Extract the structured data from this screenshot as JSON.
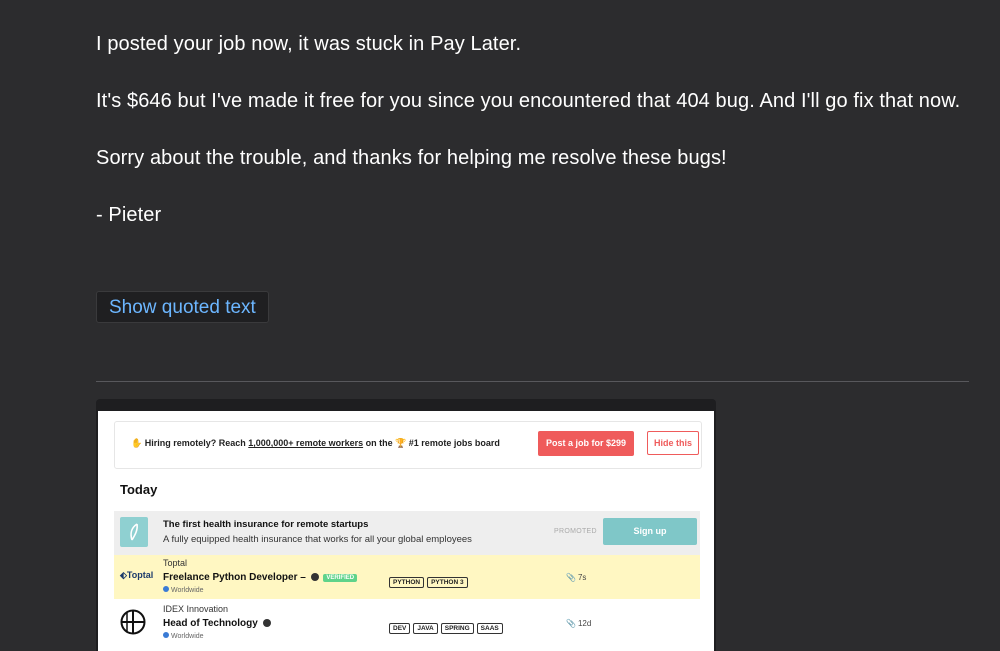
{
  "email": {
    "paragraphs": [
      "I posted your job now, it was stuck in Pay Later.",
      "It's $646 but I've made it free for you since you encountered that 404 bug. And I'll go fix that now.",
      "Sorry about the trouble, and thanks for helping me resolve these bugs!",
      "- Pieter"
    ],
    "show_quoted_label": "Show quoted text"
  },
  "embedded": {
    "banner": {
      "text_prefix": "Hiring remotely? Reach ",
      "text_highlight": "1,000,000+ remote workers",
      "text_suffix": " on the 🏆 #1 remote jobs board",
      "post_button": "Post a job for $299",
      "hide_button": "Hide this"
    },
    "section_title": "Today",
    "promo": {
      "title": "The first health insurance for remote startups",
      "subtitle": "A fully equipped health insurance that works for all your global employees",
      "promoted_label": "PROMOTED",
      "cta": "Sign up"
    },
    "jobs": [
      {
        "logo_text": "Toptal",
        "company": "Toptal",
        "title": "Freelance Python Developer –",
        "verified": "VERIFIED",
        "location": "Worldwide",
        "tags": [
          "PYTHON",
          "PYTHON 3"
        ],
        "age": "7s"
      },
      {
        "company": "IDEX Innovation",
        "title": "Head of Technology",
        "location": "Worldwide",
        "tags": [
          "DEV",
          "JAVA",
          "SPRING",
          "SAAS"
        ],
        "age": "12d"
      }
    ]
  },
  "colors": {
    "background": "#2c2c2e",
    "link": "#6cb6ff",
    "accent_red": "#ef5b5b",
    "accent_teal": "#7fc7c8",
    "highlight_row": "#fff7c2"
  }
}
